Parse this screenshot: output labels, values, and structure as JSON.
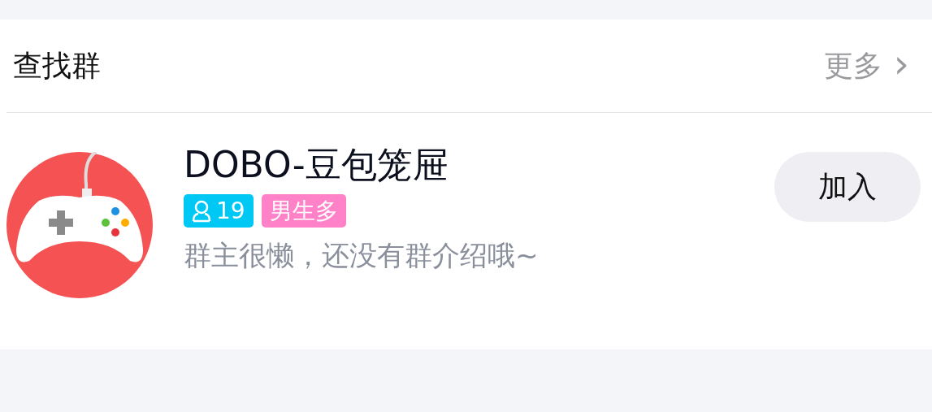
{
  "section": {
    "title": "查找群",
    "more_link": "更多",
    "more_arrow": "›"
  },
  "groups": [
    {
      "name": "DOBO-豆包笼屉",
      "tags": [
        {
          "kind": "members",
          "text": "19",
          "color": "#00c8f5"
        },
        {
          "kind": "label",
          "text": "男生多",
          "color": "#ff82c8"
        }
      ],
      "description": "群主很懒，还没有群介绍哦~",
      "join_button": "加入"
    }
  ]
}
